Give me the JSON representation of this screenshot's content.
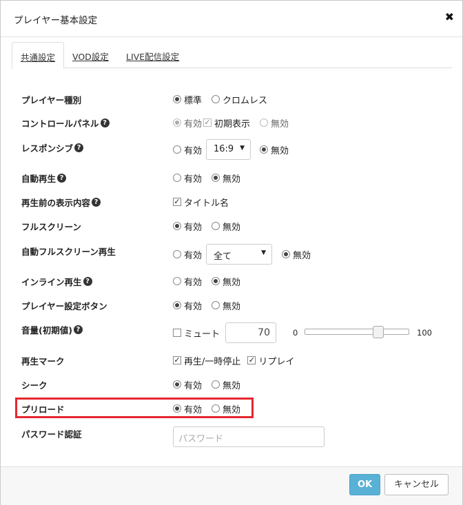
{
  "dialog": {
    "title": "プレイヤー基本設定",
    "close_label": "✖"
  },
  "tabs": [
    {
      "label": "共通設定",
      "active": true
    },
    {
      "label": "VOD設定",
      "active": false
    },
    {
      "label": "LIVE配信設定",
      "active": false
    }
  ],
  "settings": {
    "player_type": {
      "label": "プレイヤー種別",
      "options": [
        {
          "label": "標準",
          "selected": true
        },
        {
          "label": "クロムレス",
          "selected": false
        }
      ]
    },
    "control_panel": {
      "label": "コントロールパネル",
      "enabled_label": "有効",
      "initial_display_label": "初期表示",
      "disabled_label": "無効"
    },
    "responsive": {
      "label": "レスポンシブ",
      "enabled_label": "有効",
      "ratio_value": "16:9",
      "disabled_label": "無効"
    },
    "autoplay": {
      "label": "自動再生",
      "enabled_label": "有効",
      "disabled_label": "無効"
    },
    "pre_play_display": {
      "label": "再生前の表示内容",
      "title_name_label": "タイトル名"
    },
    "fullscreen": {
      "label": "フルスクリーン",
      "enabled_label": "有効",
      "disabled_label": "無効"
    },
    "auto_fullscreen": {
      "label": "自動フルスクリーン再生",
      "enabled_label": "有効",
      "select_value": "全て",
      "disabled_label": "無効"
    },
    "inline_play": {
      "label": "インライン再生",
      "enabled_label": "有効",
      "disabled_label": "無効"
    },
    "settings_button": {
      "label": "プレイヤー設定ボタン",
      "enabled_label": "有効",
      "disabled_label": "無効"
    },
    "volume": {
      "label": "音量(初期値)",
      "mute_label": "ミュート",
      "value": "70",
      "min_label": "0",
      "max_label": "100",
      "level": 0.7
    },
    "play_mark": {
      "label": "再生マーク",
      "play_pause_label": "再生/一時停止",
      "replay_label": "リプレイ"
    },
    "seek": {
      "label": "シーク",
      "enabled_label": "有効",
      "disabled_label": "無効"
    },
    "preload": {
      "label": "プリロード",
      "enabled_label": "有効",
      "disabled_label": "無効"
    },
    "password": {
      "label": "パスワード認証",
      "placeholder": "パスワード"
    }
  },
  "footer": {
    "ok_label": "OK",
    "cancel_label": "キャンセル"
  },
  "colors": {
    "ok_button": "#5ab1d6",
    "highlight_border": "#e5262f"
  }
}
